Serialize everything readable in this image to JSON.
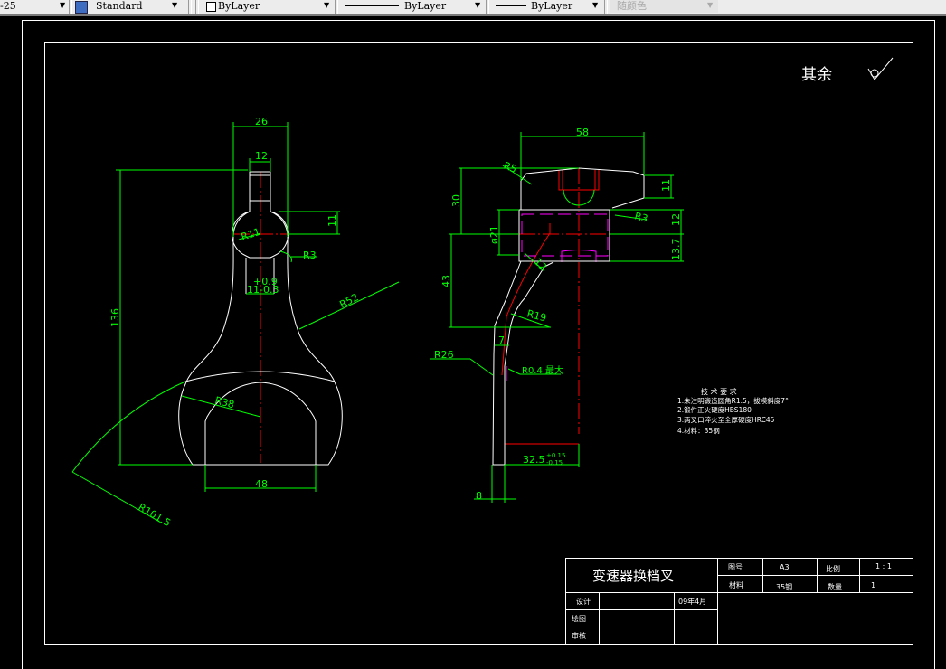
{
  "toolbar": {
    "dimstyle": "-25",
    "textstyle": "Standard",
    "layer_color": "ByLayer",
    "linetype": "ByLayer",
    "lineweight": "ByLayer",
    "plotstyle": "随颜色"
  },
  "drawing": {
    "roughness_note": "其余",
    "front_view_dims": {
      "w26": "26",
      "w12": "12",
      "h136": "136",
      "h11": "11",
      "r11": "R11",
      "r3": "R3",
      "tol_up": "+0.9",
      "tol_low": "11-0.3",
      "r52": "R52",
      "r38": "R38",
      "w48": "48",
      "r101": "R101.5"
    },
    "side_view_dims": {
      "w58": "58",
      "r5": "R5",
      "h30": "30",
      "h11": "11",
      "r3": "R3",
      "h12": "12",
      "d21": "ø21",
      "h13": "13.7",
      "h43": "43",
      "r12": "12",
      "r19": "R19",
      "w7": "7",
      "r26": "R26",
      "r04": "R0.4 最大",
      "w32": "32.5",
      "tol_up": "+0.15",
      "tol_low": "-0.15",
      "w8": "8"
    },
    "tech_requirements": {
      "title": "技 术 要 求",
      "items": [
        "1.未注明锻造圆角R1.5，拔模斜度7°",
        "2.锻件正火硬度HBS180",
        "3.两叉口淬火至全厚硬度HRC45",
        "4.材料：35钢"
      ]
    },
    "title_block": {
      "part_name": "变速器换档叉",
      "drawing_no_label": "图号",
      "drawing_no": "A3",
      "scale_label": "比例",
      "scale": "1 : 1",
      "material_label": "材料",
      "material": "35钢",
      "qty_label": "数量",
      "qty": "1",
      "design_label": "设计",
      "design_date": "09年4月",
      "draw_label": "绘图",
      "review_label": "审核"
    }
  },
  "colors": {
    "background": "#000000",
    "outline": "#ffffff",
    "dimension": "#00ff00",
    "centerline": "#ff0000",
    "hidden": "#ff00ff"
  }
}
